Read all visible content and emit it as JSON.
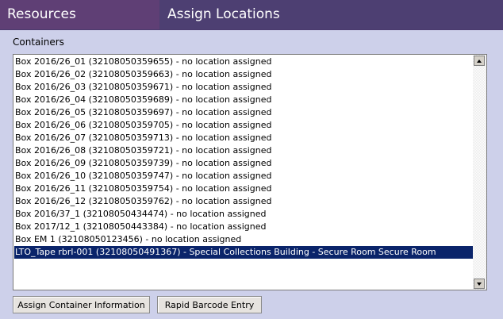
{
  "header": {
    "left_title": "Resources",
    "right_title": "Assign Locations"
  },
  "containers": {
    "label": "Containers",
    "items": [
      "Box 2016/26_01 (32108050359655) - no location assigned",
      "Box 2016/26_02 (32108050359663) - no location assigned",
      "Box 2016/26_03 (32108050359671) - no location assigned",
      "Box 2016/26_04 (32108050359689) - no location assigned",
      "Box 2016/26_05 (32108050359697) - no location assigned",
      "Box 2016/26_06 (32108050359705) - no location assigned",
      "Box 2016/26_07 (32108050359713) - no location assigned",
      "Box 2016/26_08 (32108050359721) - no location assigned",
      "Box 2016/26_09 (32108050359739) - no location assigned",
      "Box 2016/26_10 (32108050359747) - no location assigned",
      "Box 2016/26_11 (32108050359754) - no location assigned",
      "Box 2016/26_12 (32108050359762) - no location assigned",
      "Box 2016/37_1 (32108050434474) - no location assigned",
      "Box 2017/12_1 (32108050443384) - no location assigned",
      "Box EM 1 (32108050123456) - no location assigned",
      "LTO_Tape rbrl-001 (32108050491367) - Special Collections Building - Secure Room  Secure Room"
    ],
    "selected_index": 15
  },
  "buttons": {
    "assign_label": "Assign Container Information",
    "rapid_label": "Rapid Barcode Entry"
  },
  "colors": {
    "background": "#cdd0ea",
    "header_left": "#5f3f75",
    "header_right": "#4d3f72",
    "selection": "#0a246a"
  }
}
